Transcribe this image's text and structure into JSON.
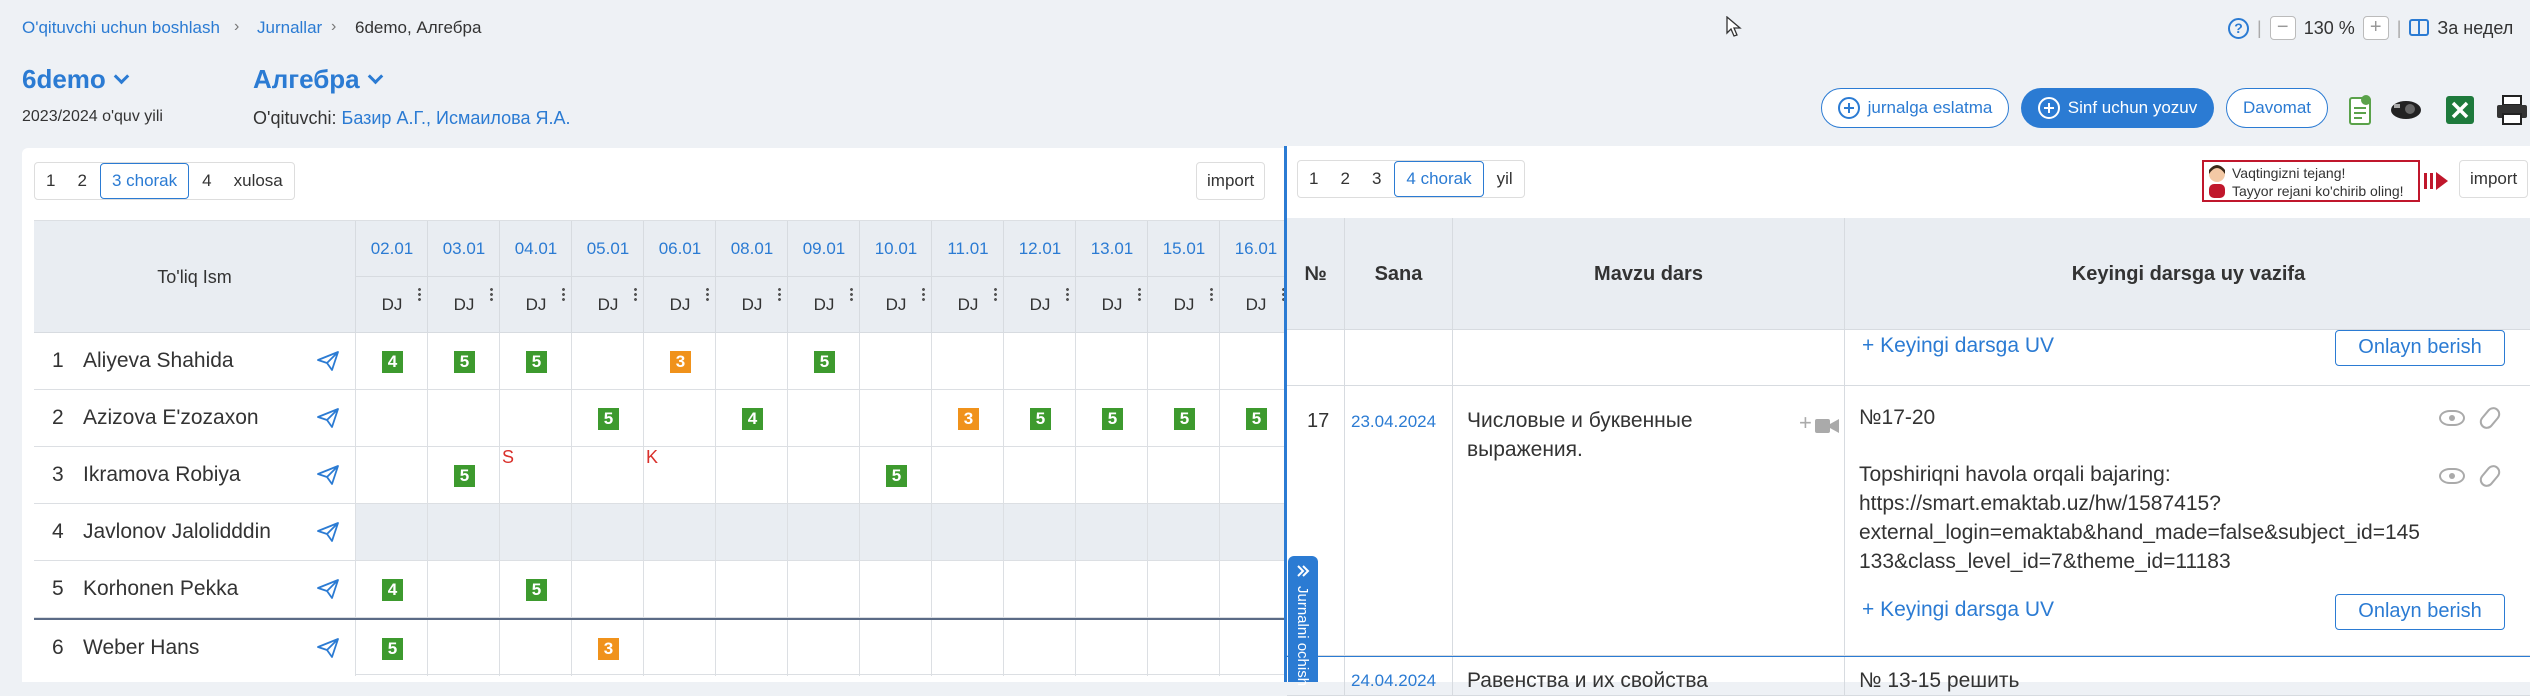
{
  "breadcrumb": {
    "items": [
      "O'qituvchi uchun boshlash",
      "Jurnallar",
      "6demo, Алгебра"
    ]
  },
  "header": {
    "group": "6demo",
    "subject": "Алгебра",
    "year": "2023/2024 o'quv yili",
    "teacher_label": "O'qituvchi:",
    "teachers": "Базир А.Г., Исмаилова Я.А."
  },
  "toolbar": {
    "zoom": "130 %",
    "week_label": "За недел",
    "reminder": "jurnalga eslatma",
    "class_note": "Sinf uchun yozuv",
    "attendance": "Davomat"
  },
  "left_panel": {
    "tabs": [
      "1",
      "2",
      "3 chorak",
      "4",
      "xulosa"
    ],
    "active_tab": "3 chorak",
    "import": "import",
    "name_header": "To'liq Ism",
    "dates": [
      "02.01",
      "03.01",
      "04.01",
      "05.01",
      "06.01",
      "08.01",
      "09.01",
      "10.01",
      "11.01",
      "12.01",
      "13.01",
      "15.01",
      "16.01"
    ],
    "type_label": "DJ",
    "students": [
      {
        "num": "1",
        "name": "Aliyeva Shahida",
        "grades": [
          "4",
          "5",
          "5",
          "",
          "3",
          "",
          "5",
          "",
          "",
          "",
          "",
          "",
          ""
        ]
      },
      {
        "num": "2",
        "name": "Azizova E'zozaxon",
        "grades": [
          "",
          "",
          "",
          "5",
          "",
          "4",
          "",
          "",
          "3",
          "5",
          "5",
          "5",
          "5"
        ]
      },
      {
        "num": "3",
        "name": "Ikramova Robiya",
        "grades": [
          "",
          "5",
          "S",
          "",
          "K",
          "",
          "",
          "5",
          "",
          "",
          "",
          "",
          ""
        ]
      },
      {
        "num": "4",
        "name": "Javlonov Jalolidddin",
        "grades": [
          "",
          "",
          "",
          "",
          "",
          "",
          "",
          "",
          "",
          "",
          "",
          "",
          ""
        ]
      },
      {
        "num": "5",
        "name": "Korhonen Pekka",
        "grades": [
          "4",
          "",
          "5",
          "",
          "",
          "",
          "",
          "",
          "",
          "",
          "",
          "",
          ""
        ]
      },
      {
        "num": "6",
        "name": "Weber Hans",
        "grades": [
          "5",
          "",
          "",
          "3",
          "",
          "",
          "",
          "",
          "",
          "",
          "",
          "",
          ""
        ]
      }
    ]
  },
  "right_panel": {
    "tabs": [
      "1",
      "2",
      "3",
      "4 chorak",
      "yil"
    ],
    "active_tab": "4 chorak",
    "import": "import",
    "promo_line1": "Vaqtingizni tejang!",
    "promo_line2": "Tayyor rejani ko'chirib oling!",
    "headers": {
      "num": "№",
      "date": "Sana",
      "topic": "Mavzu dars",
      "homework": "Keyingi darsga uy vazifa"
    },
    "add_homework": "+ Keyingi darsga UV",
    "online_button": "Onlayn berish",
    "lesson": {
      "num": "17",
      "date": "23.04.2024",
      "topic_line1": "Числовые и буквенные",
      "topic_line2": "выражения.",
      "hw1": "№17-20",
      "hw2_line1": "Topshiriqni havola orqali bajaring:",
      "hw2_line2": "https://smart.emaktab.uz/hw/1587415?",
      "hw2_line3": "external_login=emaktab&hand_made=false&subject_id=145",
      "hw2_line4": "133&class_level_id=7&theme_id=11183"
    },
    "next_date": "24.04.2024",
    "next_topic": "Равенства и их свойства",
    "next_hw": "№ 13-15 решить",
    "side_tab": "Jurnalni ochish"
  },
  "colors": {
    "accent": "#2b7bd3",
    "grade_good": "#3d9a2e",
    "grade_mid": "#f0921b",
    "mark_red": "#d9302b"
  }
}
